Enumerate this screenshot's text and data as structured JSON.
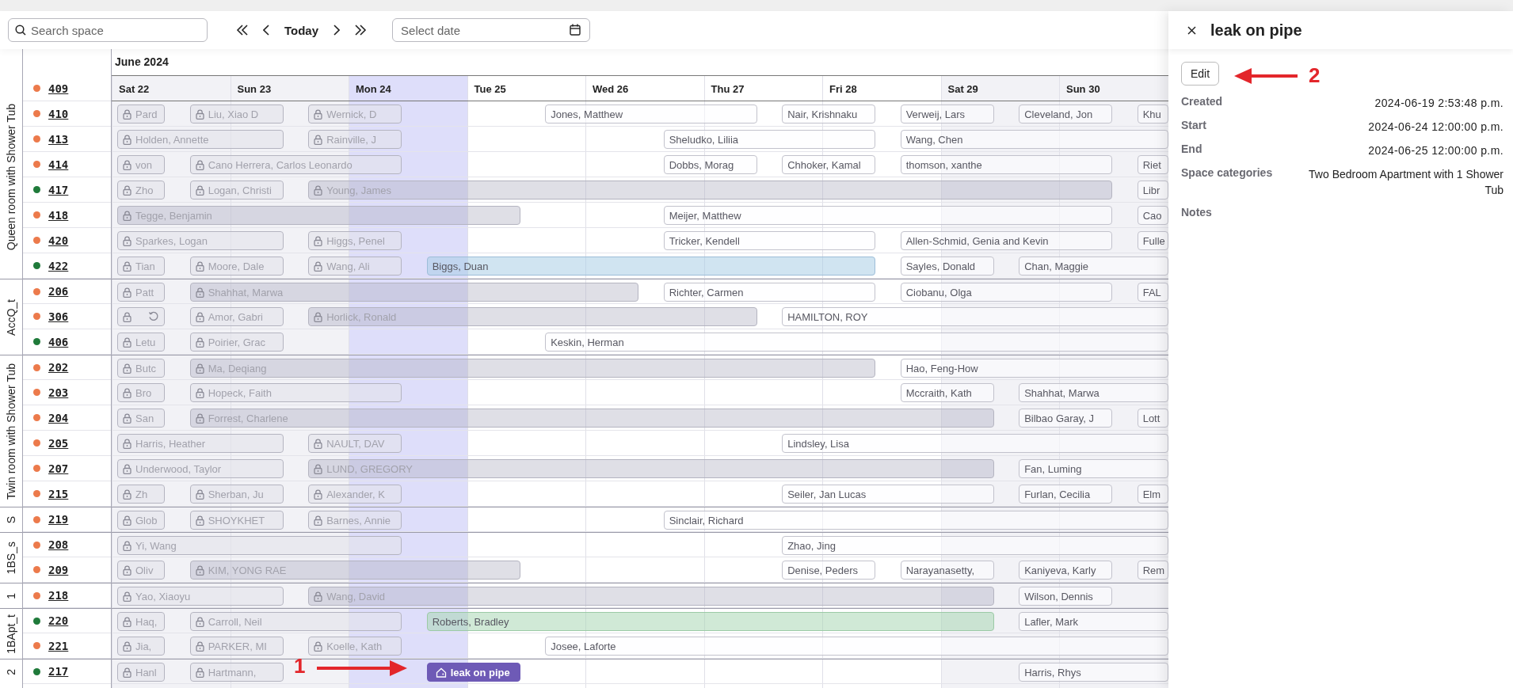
{
  "toolbar": {
    "search": {
      "placeholder": "Search space"
    },
    "today_label": "Today",
    "date_field": {
      "placeholder": "Select date"
    }
  },
  "calendar": {
    "month": "June 2024",
    "days": [
      {
        "label": "Sat 22",
        "weekend": true,
        "today": false
      },
      {
        "label": "Sun 23",
        "weekend": true,
        "today": false
      },
      {
        "label": "Mon 24",
        "weekend": false,
        "today": true
      },
      {
        "label": "Tue 25",
        "weekend": false,
        "today": false
      },
      {
        "label": "Wed 26",
        "weekend": false,
        "today": false
      },
      {
        "label": "Thu 27",
        "weekend": false,
        "today": false
      },
      {
        "label": "Fri 28",
        "weekend": false,
        "today": false
      },
      {
        "label": "Sat 29",
        "weekend": true,
        "today": false
      },
      {
        "label": "Sun 30",
        "weekend": true,
        "today": false
      }
    ],
    "groups": [
      {
        "label": "Queen room with Shower Tub",
        "rooms": [
          {
            "number": "409",
            "color": "#ec7a4b"
          },
          {
            "number": "410",
            "color": "#ec7a4b",
            "bookings": [
              {
                "name": "Pard",
                "locked": true,
                "kind": "plain"
              },
              {
                "name": "Liu, Xiao D",
                "locked": true,
                "kind": "plain"
              },
              {
                "name": "Wernick, D",
                "locked": true,
                "kind": "plain"
              },
              {
                "name": "Jones, Matthew",
                "locked": false,
                "kind": "plain"
              },
              {
                "name": "Nair, Krishnaku",
                "locked": false,
                "kind": "plain"
              },
              {
                "name": "Verweij, Lars",
                "locked": false,
                "kind": "plain"
              },
              {
                "name": "Cleveland, Jon",
                "locked": false,
                "kind": "plain"
              },
              {
                "name": "Khu",
                "locked": false,
                "kind": "plain"
              }
            ]
          },
          {
            "number": "413",
            "color": "#ec7a4b",
            "bookings": [
              {
                "name": "Holden, Annette",
                "locked": true,
                "kind": "plain"
              },
              {
                "name": "Rainville, J",
                "locked": true,
                "kind": "plain"
              },
              {
                "name": "Sheludko, Liliia",
                "locked": false,
                "kind": "plain"
              },
              {
                "name": "Wang, Chen",
                "locked": false,
                "kind": "plain"
              }
            ]
          },
          {
            "number": "414",
            "color": "#ec7a4b",
            "bookings": [
              {
                "name": "von",
                "locked": true,
                "kind": "plain"
              },
              {
                "name": "Cano Herrera, Carlos Leonardo",
                "locked": true,
                "kind": "plain"
              },
              {
                "name": "Dobbs, Morag",
                "locked": false,
                "kind": "plain"
              },
              {
                "name": "Chhoker, Kamal",
                "locked": false,
                "kind": "plain"
              },
              {
                "name": "thomson, xanthe",
                "locked": false,
                "kind": "plain"
              },
              {
                "name": "Riet",
                "locked": false,
                "kind": "plain"
              }
            ]
          },
          {
            "number": "417",
            "color": "#1f7a3a",
            "bookings": [
              {
                "name": "Zho",
                "locked": true,
                "kind": "plain"
              },
              {
                "name": "Logan, Christi",
                "locked": true,
                "kind": "plain"
              },
              {
                "name": "Young, James",
                "locked": true,
                "kind": "shaded"
              },
              {
                "name": "Libr",
                "locked": false,
                "kind": "plain"
              }
            ]
          },
          {
            "number": "418",
            "color": "#ec7a4b",
            "bookings": [
              {
                "name": "Tegge, Benjamin",
                "locked": true,
                "kind": "shaded"
              },
              {
                "name": "Meijer, Matthew",
                "locked": false,
                "kind": "plain"
              },
              {
                "name": "Cao",
                "locked": false,
                "kind": "plain"
              }
            ]
          },
          {
            "number": "420",
            "color": "#ec7a4b",
            "bookings": [
              {
                "name": "Sparkes, Logan",
                "locked": true,
                "kind": "plain"
              },
              {
                "name": "Higgs, Penel",
                "locked": true,
                "kind": "plain"
              },
              {
                "name": "Tricker, Kendell",
                "locked": false,
                "kind": "plain"
              },
              {
                "name": "Allen-Schmid, Genia and Kevin",
                "locked": false,
                "kind": "plain"
              },
              {
                "name": "Fulle",
                "locked": false,
                "kind": "plain"
              }
            ]
          },
          {
            "number": "422",
            "color": "#1f7a3a",
            "bookings": [
              {
                "name": "Tian",
                "locked": true,
                "kind": "plain"
              },
              {
                "name": "Moore, Dale",
                "locked": true,
                "kind": "plain"
              },
              {
                "name": "Wang, Ali",
                "locked": true,
                "kind": "plain"
              },
              {
                "name": "Biggs, Duan",
                "locked": false,
                "kind": "blue"
              },
              {
                "name": "Sayles, Donald",
                "locked": false,
                "kind": "plain"
              },
              {
                "name": "Chan, Maggie",
                "locked": false,
                "kind": "plain"
              }
            ]
          }
        ]
      },
      {
        "label": "AccQ_t",
        "rooms": [
          {
            "number": "206",
            "color": "#ec7a4b",
            "bookings": [
              {
                "name": "Patt",
                "locked": true,
                "kind": "plain"
              },
              {
                "name": "Shahhat, Marwa",
                "locked": true,
                "kind": "shaded"
              },
              {
                "name": "Richter, Carmen",
                "locked": false,
                "kind": "plain"
              },
              {
                "name": "Ciobanu, Olga",
                "locked": false,
                "kind": "plain"
              },
              {
                "name": "FAL",
                "locked": false,
                "kind": "plain"
              }
            ]
          },
          {
            "number": "306",
            "color": "#ec7a4b",
            "bookings": [
              {
                "locked": true,
                "kind": "sync"
              },
              {
                "name": "Amor, Gabri",
                "locked": true,
                "kind": "plain"
              },
              {
                "name": "Horlick, Ronald",
                "locked": true,
                "kind": "shaded"
              },
              {
                "name": "HAMILTON, ROY",
                "locked": false,
                "kind": "plain"
              }
            ]
          },
          {
            "number": "406",
            "color": "#1f7a3a",
            "bookings": [
              {
                "name": "Letu",
                "locked": true,
                "kind": "plain"
              },
              {
                "name": "Poirier, Grac",
                "locked": true,
                "kind": "plain"
              },
              {
                "name": "Keskin, Herman",
                "locked": false,
                "kind": "plain"
              }
            ]
          }
        ]
      },
      {
        "label": "Twin room with Shower Tub",
        "rooms": [
          {
            "number": "202",
            "color": "#ec7a4b",
            "bookings": [
              {
                "name": "Butc",
                "locked": true,
                "kind": "plain"
              },
              {
                "name": "Ma, Deqiang",
                "locked": true,
                "kind": "shaded"
              },
              {
                "name": "Hao, Feng-How",
                "locked": false,
                "kind": "plain"
              }
            ]
          },
          {
            "number": "203",
            "color": "#ec7a4b",
            "bookings": [
              {
                "name": "Bro",
                "locked": true,
                "kind": "plain"
              },
              {
                "name": "Hopeck, Faith",
                "locked": true,
                "kind": "plain"
              },
              {
                "name": "Mccraith, Kath",
                "locked": false,
                "kind": "plain"
              },
              {
                "name": "Shahhat, Marwa",
                "locked": false,
                "kind": "plain"
              }
            ]
          },
          {
            "number": "204",
            "color": "#ec7a4b",
            "bookings": [
              {
                "name": "San",
                "locked": true,
                "kind": "plain"
              },
              {
                "name": "Forrest, Charlene",
                "locked": true,
                "kind": "shaded"
              },
              {
                "name": "Bilbao Garay, J",
                "locked": false,
                "kind": "plain"
              },
              {
                "name": "Lott",
                "locked": false,
                "kind": "plain"
              }
            ]
          },
          {
            "number": "205",
            "color": "#ec7a4b",
            "bookings": [
              {
                "name": "Harris, Heather",
                "locked": true,
                "kind": "plain"
              },
              {
                "name": "NAULT, DAV",
                "locked": true,
                "kind": "plain"
              },
              {
                "name": "Lindsley, Lisa",
                "locked": false,
                "kind": "plain"
              }
            ]
          },
          {
            "number": "207",
            "color": "#ec7a4b",
            "bookings": [
              {
                "name": "Underwood, Taylor",
                "locked": true,
                "kind": "plain"
              },
              {
                "name": "LUND, GREGORY",
                "locked": true,
                "kind": "shaded"
              },
              {
                "name": "Fan, Luming",
                "locked": false,
                "kind": "plain"
              }
            ]
          },
          {
            "number": "215",
            "color": "#ec7a4b",
            "bookings": [
              {
                "name": "Zh",
                "locked": true,
                "kind": "plain"
              },
              {
                "name": "Sherban, Ju",
                "locked": true,
                "kind": "plain"
              },
              {
                "name": "Alexander, K",
                "locked": true,
                "kind": "plain"
              },
              {
                "name": "Seiler, Jan Lucas",
                "locked": false,
                "kind": "plain"
              },
              {
                "name": "Furlan, Cecilia",
                "locked": false,
                "kind": "plain"
              },
              {
                "name": "Elm",
                "locked": false,
                "kind": "plain"
              }
            ]
          }
        ]
      },
      {
        "label": "S",
        "rooms": [
          {
            "number": "219",
            "color": "#ec7a4b",
            "bookings": [
              {
                "name": "Glob",
                "locked": true,
                "kind": "plain"
              },
              {
                "name": "SHOYKHET",
                "locked": true,
                "kind": "plain"
              },
              {
                "name": "Barnes, Annie",
                "locked": true,
                "kind": "plain"
              },
              {
                "name": "Sinclair, Richard",
                "locked": false,
                "kind": "plain"
              }
            ]
          }
        ]
      },
      {
        "label": "1BS_s",
        "rooms": [
          {
            "number": "208",
            "color": "#ec7a4b",
            "bookings": [
              {
                "name": "Yi, Wang",
                "locked": true,
                "kind": "plain"
              },
              {
                "name": "Zhao, Jing",
                "locked": false,
                "kind": "plain"
              }
            ]
          },
          {
            "number": "209",
            "color": "#ec7a4b",
            "bookings": [
              {
                "name": "Oliv",
                "locked": true,
                "kind": "plain"
              },
              {
                "name": "KIM, YONG RAE",
                "locked": true,
                "kind": "shaded"
              },
              {
                "name": "Denise, Peders",
                "locked": false,
                "kind": "plain"
              },
              {
                "name": "Narayanasetty,",
                "locked": false,
                "kind": "plain"
              },
              {
                "name": "Kaniyeva, Karly",
                "locked": false,
                "kind": "plain"
              },
              {
                "name": "Rem",
                "locked": false,
                "kind": "plain"
              }
            ]
          }
        ]
      },
      {
        "label": "1",
        "rooms": [
          {
            "number": "218",
            "color": "#ec7a4b",
            "bookings": [
              {
                "name": "Yao, Xiaoyu",
                "locked": true,
                "kind": "plain"
              },
              {
                "name": "Wang, David",
                "locked": true,
                "kind": "shaded"
              },
              {
                "name": "Wilson, Dennis",
                "locked": false,
                "kind": "plain"
              }
            ]
          }
        ]
      },
      {
        "label": "1BApt_t",
        "rooms": [
          {
            "number": "220",
            "color": "#1f7a3a",
            "bookings": [
              {
                "name": "Haq,",
                "locked": true,
                "kind": "plain"
              },
              {
                "name": "Carroll, Neil",
                "locked": true,
                "kind": "plain"
              },
              {
                "name": "Roberts, Bradley",
                "locked": false,
                "kind": "green"
              },
              {
                "name": "Lafler, Mark",
                "locked": false,
                "kind": "plain"
              }
            ]
          },
          {
            "number": "221",
            "color": "#ec7a4b",
            "bookings": [
              {
                "name": "Jia,",
                "locked": true,
                "kind": "plain"
              },
              {
                "name": "PARKER, MI",
                "locked": true,
                "kind": "plain"
              },
              {
                "name": "Koelle, Kath",
                "locked": true,
                "kind": "plain"
              },
              {
                "name": "Josee, Laforte",
                "locked": false,
                "kind": "plain"
              }
            ]
          }
        ]
      },
      {
        "label": "2",
        "rooms": [
          {
            "number": "217",
            "color": "#1f7a3a",
            "bookings": [
              {
                "name": "Hanl",
                "locked": true,
                "kind": "plain"
              },
              {
                "name": "Hartmann,",
                "locked": true,
                "kind": "plain"
              },
              {
                "name": "leak on pipe",
                "locked": false,
                "kind": "maintenance"
              },
              {
                "name": "Harris, Rhys",
                "locked": false,
                "kind": "plain"
              }
            ]
          }
        ]
      }
    ]
  },
  "panel": {
    "title": "leak on pipe",
    "edit_label": "Edit",
    "details": [
      {
        "label": "Created",
        "value": "2024-06-19 2:53:48 p.m.",
        "kind": "datetime"
      },
      {
        "label": "Start",
        "value": "2024-06-24 12:00:00 p.m.",
        "kind": "datetime"
      },
      {
        "label": "End",
        "value": "2024-06-25 12:00:00 p.m.",
        "kind": "datetime"
      },
      {
        "label": "Space categories",
        "value": "Two Bedroom Apartment with 1 Shower Tub",
        "kind": "text"
      },
      {
        "label": "Notes",
        "kind": "empty"
      }
    ]
  },
  "annotations": [
    {
      "label": "1"
    },
    {
      "label": "2"
    }
  ]
}
